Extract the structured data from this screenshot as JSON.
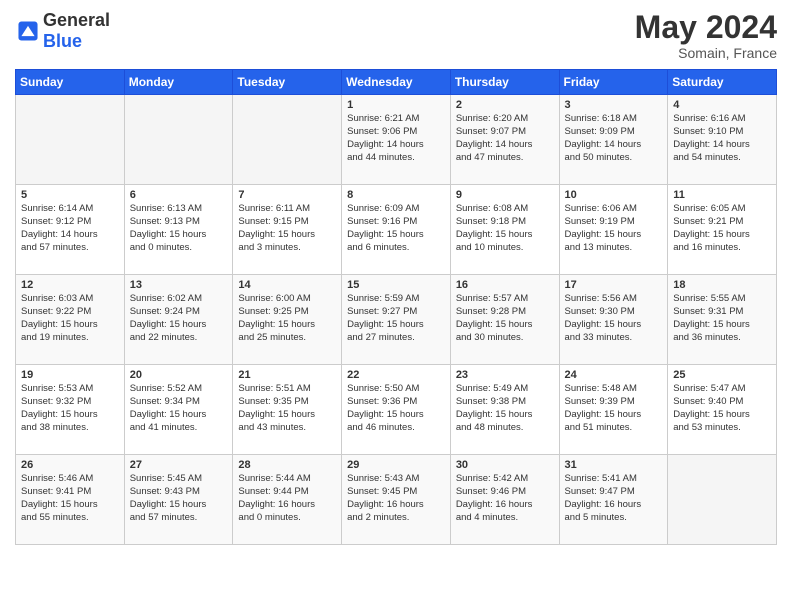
{
  "header": {
    "logo_general": "General",
    "logo_blue": "Blue",
    "month": "May 2024",
    "location": "Somain, France"
  },
  "days_of_week": [
    "Sunday",
    "Monday",
    "Tuesday",
    "Wednesday",
    "Thursday",
    "Friday",
    "Saturday"
  ],
  "weeks": [
    {
      "cells": [
        {
          "day": "",
          "content": ""
        },
        {
          "day": "",
          "content": ""
        },
        {
          "day": "",
          "content": ""
        },
        {
          "day": "1",
          "content": "Sunrise: 6:21 AM\nSunset: 9:06 PM\nDaylight: 14 hours\nand 44 minutes."
        },
        {
          "day": "2",
          "content": "Sunrise: 6:20 AM\nSunset: 9:07 PM\nDaylight: 14 hours\nand 47 minutes."
        },
        {
          "day": "3",
          "content": "Sunrise: 6:18 AM\nSunset: 9:09 PM\nDaylight: 14 hours\nand 50 minutes."
        },
        {
          "day": "4",
          "content": "Sunrise: 6:16 AM\nSunset: 9:10 PM\nDaylight: 14 hours\nand 54 minutes."
        }
      ]
    },
    {
      "cells": [
        {
          "day": "5",
          "content": "Sunrise: 6:14 AM\nSunset: 9:12 PM\nDaylight: 14 hours\nand 57 minutes."
        },
        {
          "day": "6",
          "content": "Sunrise: 6:13 AM\nSunset: 9:13 PM\nDaylight: 15 hours\nand 0 minutes."
        },
        {
          "day": "7",
          "content": "Sunrise: 6:11 AM\nSunset: 9:15 PM\nDaylight: 15 hours\nand 3 minutes."
        },
        {
          "day": "8",
          "content": "Sunrise: 6:09 AM\nSunset: 9:16 PM\nDaylight: 15 hours\nand 6 minutes."
        },
        {
          "day": "9",
          "content": "Sunrise: 6:08 AM\nSunset: 9:18 PM\nDaylight: 15 hours\nand 10 minutes."
        },
        {
          "day": "10",
          "content": "Sunrise: 6:06 AM\nSunset: 9:19 PM\nDaylight: 15 hours\nand 13 minutes."
        },
        {
          "day": "11",
          "content": "Sunrise: 6:05 AM\nSunset: 9:21 PM\nDaylight: 15 hours\nand 16 minutes."
        }
      ]
    },
    {
      "cells": [
        {
          "day": "12",
          "content": "Sunrise: 6:03 AM\nSunset: 9:22 PM\nDaylight: 15 hours\nand 19 minutes."
        },
        {
          "day": "13",
          "content": "Sunrise: 6:02 AM\nSunset: 9:24 PM\nDaylight: 15 hours\nand 22 minutes."
        },
        {
          "day": "14",
          "content": "Sunrise: 6:00 AM\nSunset: 9:25 PM\nDaylight: 15 hours\nand 25 minutes."
        },
        {
          "day": "15",
          "content": "Sunrise: 5:59 AM\nSunset: 9:27 PM\nDaylight: 15 hours\nand 27 minutes."
        },
        {
          "day": "16",
          "content": "Sunrise: 5:57 AM\nSunset: 9:28 PM\nDaylight: 15 hours\nand 30 minutes."
        },
        {
          "day": "17",
          "content": "Sunrise: 5:56 AM\nSunset: 9:30 PM\nDaylight: 15 hours\nand 33 minutes."
        },
        {
          "day": "18",
          "content": "Sunrise: 5:55 AM\nSunset: 9:31 PM\nDaylight: 15 hours\nand 36 minutes."
        }
      ]
    },
    {
      "cells": [
        {
          "day": "19",
          "content": "Sunrise: 5:53 AM\nSunset: 9:32 PM\nDaylight: 15 hours\nand 38 minutes."
        },
        {
          "day": "20",
          "content": "Sunrise: 5:52 AM\nSunset: 9:34 PM\nDaylight: 15 hours\nand 41 minutes."
        },
        {
          "day": "21",
          "content": "Sunrise: 5:51 AM\nSunset: 9:35 PM\nDaylight: 15 hours\nand 43 minutes."
        },
        {
          "day": "22",
          "content": "Sunrise: 5:50 AM\nSunset: 9:36 PM\nDaylight: 15 hours\nand 46 minutes."
        },
        {
          "day": "23",
          "content": "Sunrise: 5:49 AM\nSunset: 9:38 PM\nDaylight: 15 hours\nand 48 minutes."
        },
        {
          "day": "24",
          "content": "Sunrise: 5:48 AM\nSunset: 9:39 PM\nDaylight: 15 hours\nand 51 minutes."
        },
        {
          "day": "25",
          "content": "Sunrise: 5:47 AM\nSunset: 9:40 PM\nDaylight: 15 hours\nand 53 minutes."
        }
      ]
    },
    {
      "cells": [
        {
          "day": "26",
          "content": "Sunrise: 5:46 AM\nSunset: 9:41 PM\nDaylight: 15 hours\nand 55 minutes."
        },
        {
          "day": "27",
          "content": "Sunrise: 5:45 AM\nSunset: 9:43 PM\nDaylight: 15 hours\nand 57 minutes."
        },
        {
          "day": "28",
          "content": "Sunrise: 5:44 AM\nSunset: 9:44 PM\nDaylight: 16 hours\nand 0 minutes."
        },
        {
          "day": "29",
          "content": "Sunrise: 5:43 AM\nSunset: 9:45 PM\nDaylight: 16 hours\nand 2 minutes."
        },
        {
          "day": "30",
          "content": "Sunrise: 5:42 AM\nSunset: 9:46 PM\nDaylight: 16 hours\nand 4 minutes."
        },
        {
          "day": "31",
          "content": "Sunrise: 5:41 AM\nSunset: 9:47 PM\nDaylight: 16 hours\nand 5 minutes."
        },
        {
          "day": "",
          "content": ""
        }
      ]
    }
  ]
}
